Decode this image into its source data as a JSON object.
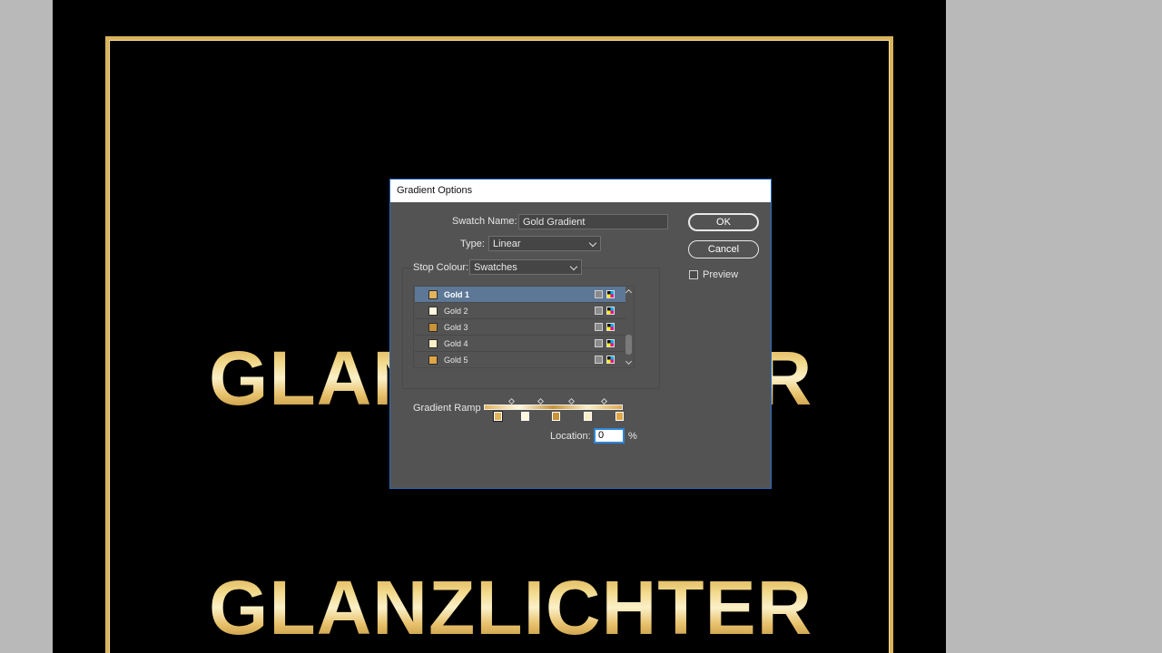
{
  "artwork": {
    "headline_top": "GLANZLICHTER",
    "headline_bottom": "GLANZLICHTER"
  },
  "dialog": {
    "title": "Gradient Options",
    "swatch_name_label": "Swatch Name:",
    "swatch_name_value": "Gold Gradient",
    "type_label": "Type:",
    "type_value": "Linear",
    "stop_colour_label": "Stop Colour:",
    "stop_colour_value": "Swatches",
    "ok_label": "OK",
    "cancel_label": "Cancel",
    "preview_label": "Preview",
    "preview_checked": false,
    "gradient_ramp_label": "Gradient Ramp",
    "location_label": "Location:",
    "location_value": "0",
    "location_unit": "%"
  },
  "swatches": [
    {
      "name": "Gold 1",
      "color": "#e3b45a",
      "selected": true
    },
    {
      "name": "Gold 2",
      "color": "#fff7de",
      "selected": false
    },
    {
      "name": "Gold 3",
      "color": "#c89236",
      "selected": false
    },
    {
      "name": "Gold 4",
      "color": "#fbefc4",
      "selected": false
    },
    {
      "name": "Gold 5",
      "color": "#e0a548",
      "selected": false
    }
  ],
  "icons": {
    "swatch_gray": "process-gray-icon",
    "swatch_cmyk": "cmyk-mode-icon"
  }
}
